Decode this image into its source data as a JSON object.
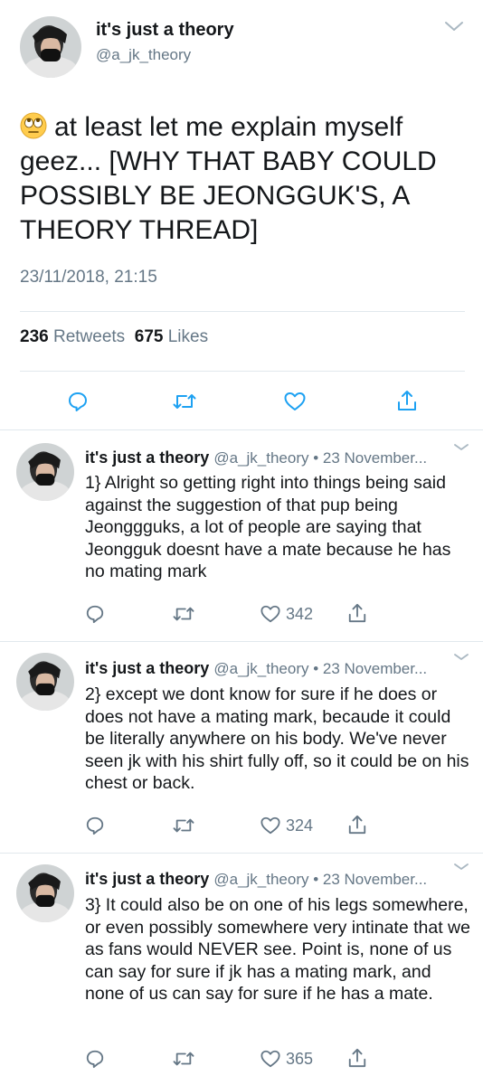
{
  "main_tweet": {
    "display_name": "it's just a theory",
    "handle": "@a_jk_theory",
    "text": "at least let me explain myself geez... [WHY THAT BABY COULD POSSIBLY BE JEONGGUK'S, A THEORY THREAD]",
    "emoji": "face-with-rolling-eyes",
    "timestamp": "23/11/2018, 21:15",
    "retweets_count": "236",
    "retweets_label": "Retweets",
    "likes_count": "675",
    "likes_label": "Likes",
    "icons": [
      "reply-icon",
      "retweet-icon",
      "like-icon",
      "share-icon"
    ]
  },
  "replies": [
    {
      "display_name": "it's just a theory",
      "meta": "@a_jk_theory • 23 November...",
      "text": "1} Alright so getting right into things being said against the suggestion of that pup being Jeonggguks, a lot of people are saying that Jeongguk doesnt have a mate because he has no mating mark",
      "likes": "342"
    },
    {
      "display_name": "it's just a theory",
      "meta": "@a_jk_theory • 23 November...",
      "text": "2} except we dont know for sure if he does or does not have a mating mark, becaude it could be literally anywhere on his body. We've never seen jk with his shirt fully off, so it could be on his chest or back.",
      "likes": "324"
    },
    {
      "display_name": "it's just a theory",
      "meta": "@a_jk_theory • 23 November...",
      "text": "3} It could also be on one of his legs somewhere, or even possibly somewhere very intinate that we as fans would NEVER see. Point is, none of us can say for sure if jk has a mating mark, and none of us can say for sure if he has a mate.",
      "likes": "365"
    }
  ],
  "colors": {
    "text": "#14171a",
    "secondary": "#657786",
    "divider": "#e1e8ed",
    "icon": "#1da1f2"
  }
}
